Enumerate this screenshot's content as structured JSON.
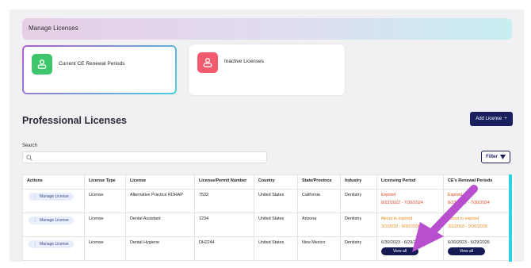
{
  "header": {
    "title": "Manage Licenses"
  },
  "cards": [
    {
      "label": "Current CE Renewal Periods",
      "icon": "people-icon",
      "color": "#3fc66c",
      "selected": true
    },
    {
      "label": "Inactive Licenses",
      "icon": "people-icon",
      "color": "#f25b6e",
      "selected": false
    }
  ],
  "section": {
    "title": "Professional Licenses",
    "add_label": "Add License",
    "add_icon": "+"
  },
  "search": {
    "label": "Search",
    "placeholder": ""
  },
  "filter": {
    "label": "Filter"
  },
  "table": {
    "columns": [
      "Actions",
      "License Type",
      "License",
      "License/Permit Number",
      "Country",
      "State/Province",
      "Industry",
      "Licensing Period",
      "CE's Renewal Periods"
    ],
    "rows": [
      {
        "action": "Manage License",
        "type": "License",
        "license": "Alternative Practice RDHAP",
        "number": "7532",
        "country": "United States",
        "state": "California",
        "industry": "Dentistry",
        "period_status": "Expired",
        "period_dates": "8/22/2022 - 7/30/2024",
        "ce_status": "Expired",
        "ce_dates": "8/22/2022 - 7/30/2024"
      },
      {
        "action": "Manage License",
        "type": "License",
        "license": "Dental Assistant",
        "number": "1234",
        "country": "United States",
        "state": "Arizona",
        "industry": "Dentistry",
        "period_status": "About to expired",
        "period_dates": "3/1/2018 - 9/30/2026",
        "ce_status": "About to expired",
        "ce_dates": "3/1/2018 - 9/30/2026"
      },
      {
        "action": "Manage License",
        "type": "License",
        "license": "Dental Hygiene",
        "number": "DH2244",
        "country": "United States",
        "state": "New Mexico",
        "industry": "Dentistry",
        "period_status": "",
        "period_dates": "6/30/2023 - 6/29/2026",
        "ce_status": "",
        "ce_dates": "6/30/2023 - 6/29/2026",
        "view_all": "View all"
      }
    ]
  },
  "colors": {
    "accent": "#1a1f5e",
    "expired": "#e8461f",
    "warning": "#e98a1d",
    "arrow": "#b84fcf",
    "edge": "#2ad4e3"
  }
}
